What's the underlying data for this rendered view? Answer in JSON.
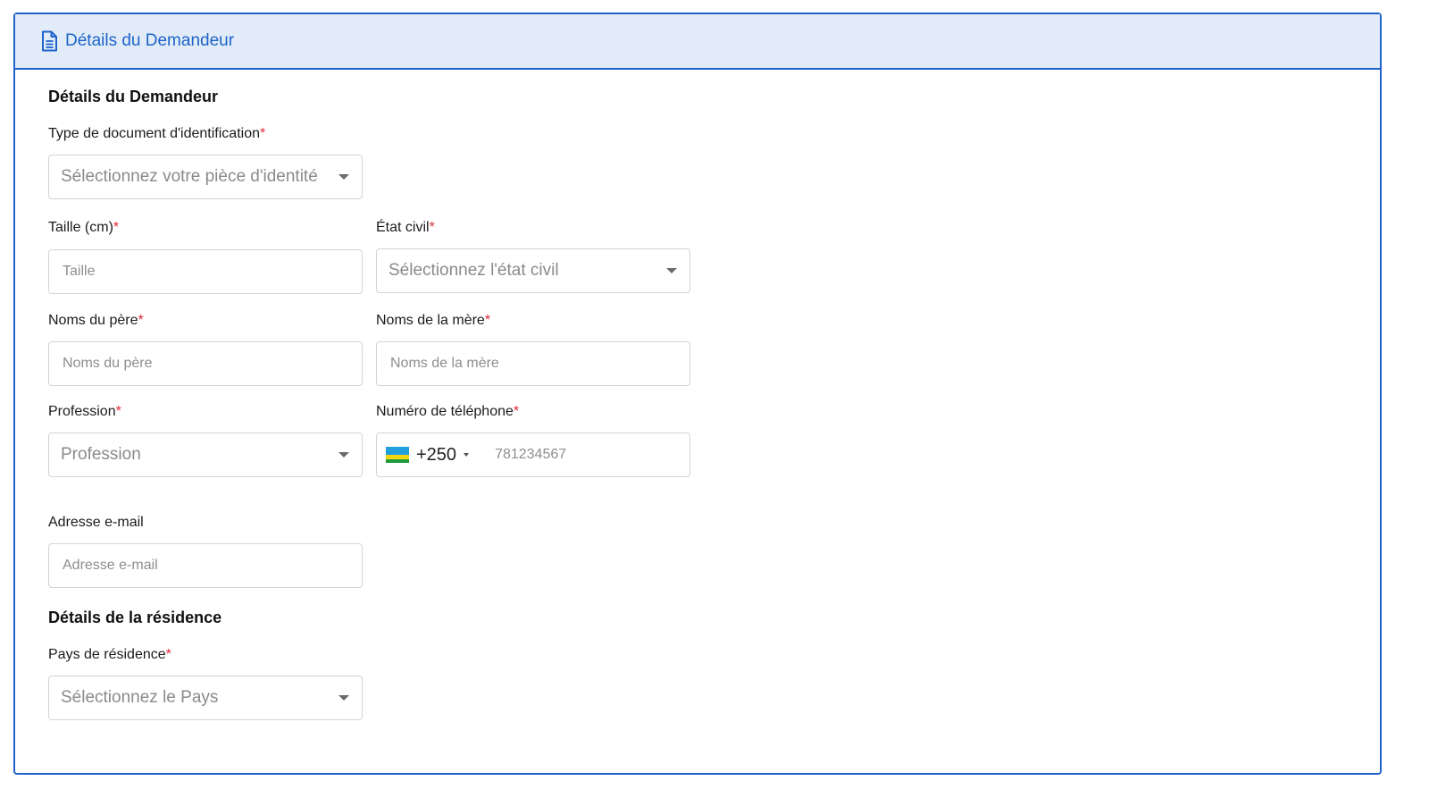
{
  "header": {
    "icon": "document-icon",
    "title": "Détails du Demandeur"
  },
  "applicant": {
    "section_title": "Détails du Demandeur",
    "id_type": {
      "label": "Type de document d'identification",
      "required": "*",
      "placeholder": "Sélectionnez votre pièce d'identité"
    },
    "height": {
      "label": "Taille (cm)",
      "required": "*",
      "placeholder": "Taille"
    },
    "civil_status": {
      "label": "État civil",
      "required": "*",
      "placeholder": "Sélectionnez l'état civil"
    },
    "father_names": {
      "label": "Noms du père",
      "required": "*",
      "placeholder": "Noms du père"
    },
    "mother_names": {
      "label": "Noms de la mère",
      "required": "*",
      "placeholder": "Noms de la mère"
    },
    "profession": {
      "label": "Profession",
      "required": "*",
      "placeholder": "Profession"
    },
    "phone": {
      "label": "Numéro de téléphone",
      "required": "*",
      "flag": "rwanda-flag-icon",
      "dial_code": "+250",
      "placeholder": "781234567"
    },
    "email": {
      "label": "Adresse e-mail",
      "placeholder": "Adresse e-mail"
    }
  },
  "residence": {
    "section_title": "Détails de la résidence",
    "country": {
      "label": "Pays de résidence",
      "required": "*",
      "placeholder": "Sélectionnez le Pays"
    }
  },
  "colors": {
    "accent": "#2262c6",
    "header_bg": "#e1ecf8",
    "required": "#e0283b"
  }
}
